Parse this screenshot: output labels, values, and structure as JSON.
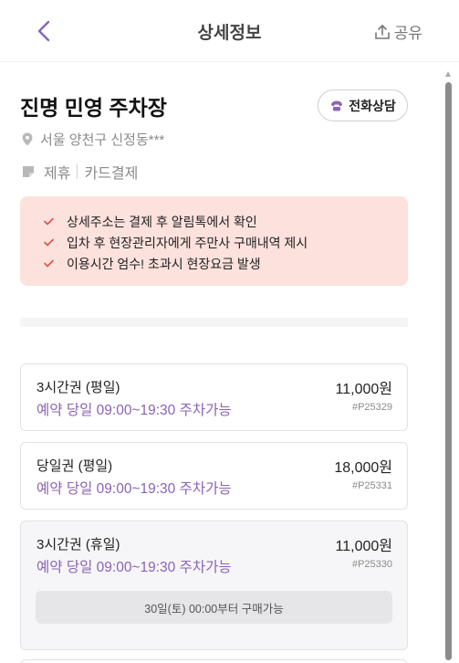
{
  "header": {
    "title": "상세정보",
    "share_label": "공유"
  },
  "lot": {
    "name": "진명 민영 주차장",
    "consult_label": "전화상담",
    "address": "서울 양천구 신정동***",
    "tags": [
      "제휴",
      "카드결제"
    ]
  },
  "notice": {
    "items": [
      "상세주소는 결제 후 알림톡에서 확인",
      "입차 후 현장관리자에게 주만사 구매내역 제시",
      "이용시간 엄수! 초과시 현장요금 발생"
    ]
  },
  "tickets": [
    {
      "name": "3시간권 (평일)",
      "time": "예약 당일 09:00~19:30 주차가능",
      "price": "11,000원",
      "code": "#P25329",
      "availability": ""
    },
    {
      "name": "당일권 (평일)",
      "time": "예약 당일 09:00~19:30 주차가능",
      "price": "18,000원",
      "code": "#P25331",
      "availability": ""
    },
    {
      "name": "3시간권 (휴일)",
      "time": "예약 당일 09:00~19:30 주차가능",
      "price": "11,000원",
      "code": "#P25330",
      "availability": "30일(토) 00:00부터 구매가능"
    }
  ],
  "colors": {
    "accent": "#8a63b5",
    "notice_bg": "#fde1dc",
    "check": "#e0513f"
  }
}
